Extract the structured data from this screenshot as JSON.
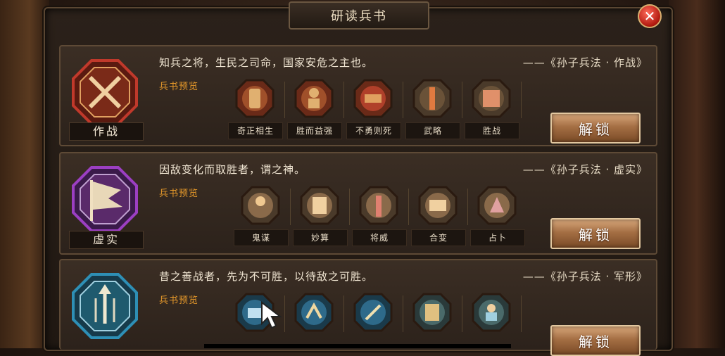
{
  "window": {
    "title": "研读兵书",
    "close_icon": "close-icon"
  },
  "preview_label": "兵书预览",
  "unlock_label": "解锁",
  "panels": [
    {
      "name": "作战",
      "quote": "知兵之将，生民之司命，国家安危之主也。",
      "source": "——《孙子兵法 · 作战》",
      "accent": "#c0392b",
      "badge_icon": "crossed-swords-icon",
      "skills": [
        "奇正相生",
        "胜而益强",
        "不勇则死",
        "武略",
        "胜战",
        ""
      ]
    },
    {
      "name": "虚实",
      "quote": "因敌变化而取胜者，谓之神。",
      "source": "——《孙子兵法 · 虚实》",
      "accent": "#9b3fc2",
      "badge_icon": "banner-flag-icon",
      "skills": [
        "鬼谋",
        "妙算",
        "将威",
        "合变",
        "占卜"
      ]
    },
    {
      "name": "",
      "quote": "昔之善战者，先为不可胜，以待敌之可胜。",
      "source": "——《孙子兵法 · 军形》",
      "accent": "#2e8fb5",
      "badge_icon": "arrow-shield-icon",
      "skills": [
        "",
        "",
        "",
        "",
        "",
        ""
      ]
    }
  ]
}
